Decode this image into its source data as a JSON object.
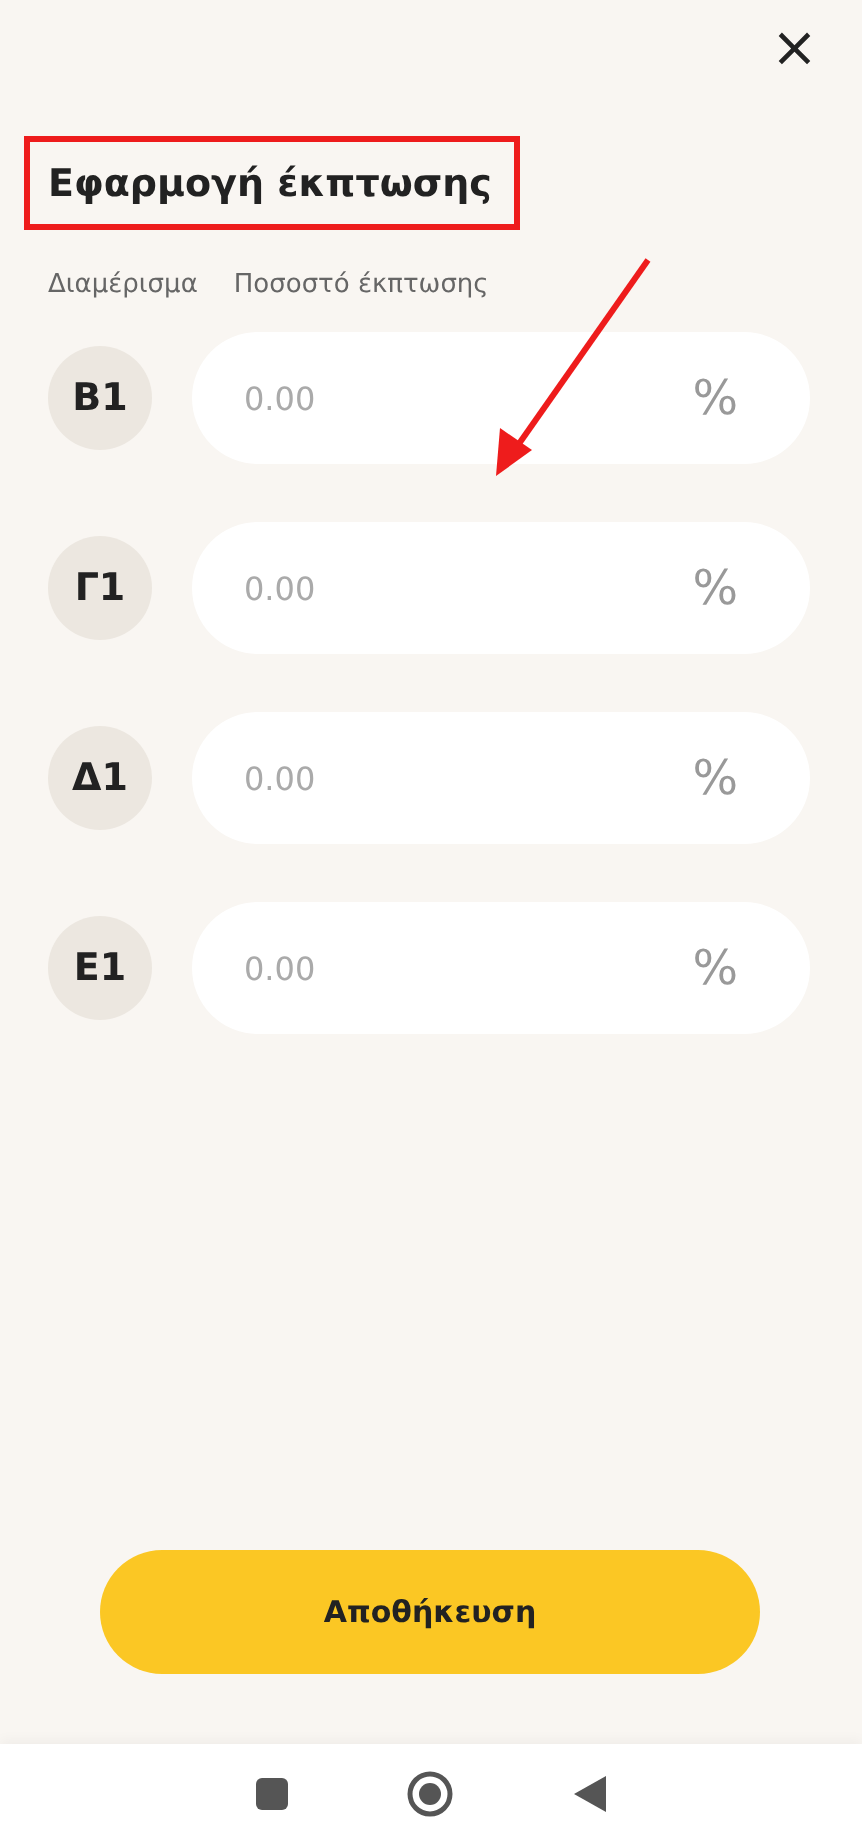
{
  "close_icon": "×",
  "title": "Εφαρμογή έκπτωσης",
  "columns": [
    "Διαμέρισμα",
    "Ποσοστό έκπτωσης"
  ],
  "rows": [
    {
      "unit": "Β1",
      "placeholder": "0.00",
      "suffix": "%"
    },
    {
      "unit": "Γ1",
      "placeholder": "0.00",
      "suffix": "%"
    },
    {
      "unit": "Δ1",
      "placeholder": "0.00",
      "suffix": "%"
    },
    {
      "unit": "Ε1",
      "placeholder": "0.00",
      "suffix": "%"
    }
  ],
  "save_button": "Αποθήκευση"
}
